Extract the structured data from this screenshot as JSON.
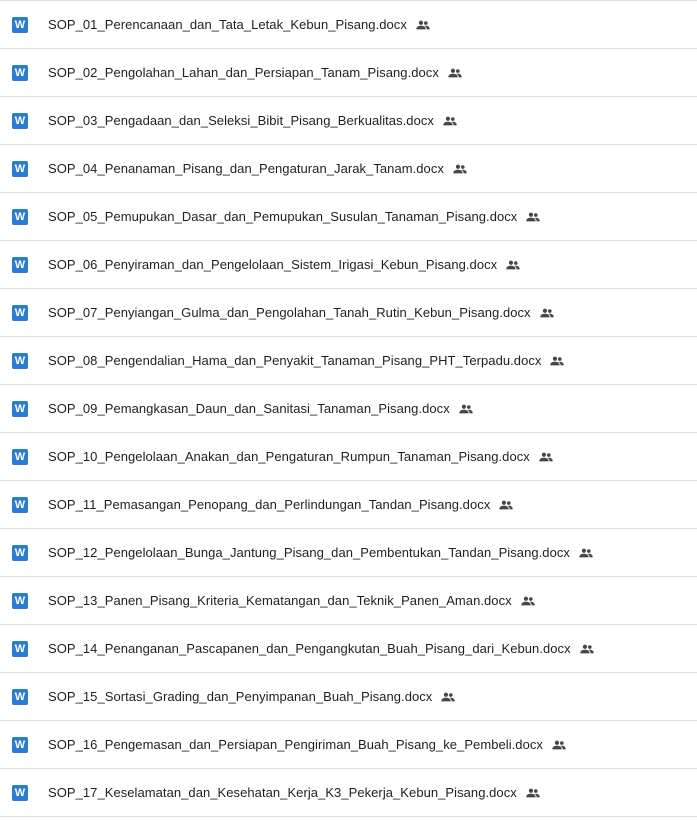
{
  "icons": {
    "file_type": "word-icon",
    "file_type_letter": "W",
    "shared": "shared-people-icon"
  },
  "colors": {
    "word_blue": "#2b7cd3",
    "text": "#1f1f1f",
    "divider": "#dadce0",
    "shared_icon": "#444746"
  },
  "files": [
    {
      "name": "SOP_01_Perencanaan_dan_Tata_Letak_Kebun_Pisang.docx"
    },
    {
      "name": "SOP_02_Pengolahan_Lahan_dan_Persiapan_Tanam_Pisang.docx"
    },
    {
      "name": "SOP_03_Pengadaan_dan_Seleksi_Bibit_Pisang_Berkualitas.docx"
    },
    {
      "name": "SOP_04_Penanaman_Pisang_dan_Pengaturan_Jarak_Tanam.docx"
    },
    {
      "name": "SOP_05_Pemupukan_Dasar_dan_Pemupukan_Susulan_Tanaman_Pisang.docx"
    },
    {
      "name": "SOP_06_Penyiraman_dan_Pengelolaan_Sistem_Irigasi_Kebun_Pisang.docx"
    },
    {
      "name": "SOP_07_Penyiangan_Gulma_dan_Pengolahan_Tanah_Rutin_Kebun_Pisang.docx"
    },
    {
      "name": "SOP_08_Pengendalian_Hama_dan_Penyakit_Tanaman_Pisang_PHT_Terpadu.docx"
    },
    {
      "name": "SOP_09_Pemangkasan_Daun_dan_Sanitasi_Tanaman_Pisang.docx"
    },
    {
      "name": "SOP_10_Pengelolaan_Anakan_dan_Pengaturan_Rumpun_Tanaman_Pisang.docx"
    },
    {
      "name": "SOP_11_Pemasangan_Penopang_dan_Perlindungan_Tandan_Pisang.docx"
    },
    {
      "name": "SOP_12_Pengelolaan_Bunga_Jantung_Pisang_dan_Pembentukan_Tandan_Pisang.docx"
    },
    {
      "name": "SOP_13_Panen_Pisang_Kriteria_Kematangan_dan_Teknik_Panen_Aman.docx"
    },
    {
      "name": "SOP_14_Penanganan_Pascapanen_dan_Pengangkutan_Buah_Pisang_dari_Kebun.docx"
    },
    {
      "name": "SOP_15_Sortasi_Grading_dan_Penyimpanan_Buah_Pisang.docx"
    },
    {
      "name": "SOP_16_Pengemasan_dan_Persiapan_Pengiriman_Buah_Pisang_ke_Pembeli.docx"
    },
    {
      "name": "SOP_17_Keselamatan_dan_Kesehatan_Kerja_K3_Pekerja_Kebun_Pisang.docx"
    }
  ]
}
